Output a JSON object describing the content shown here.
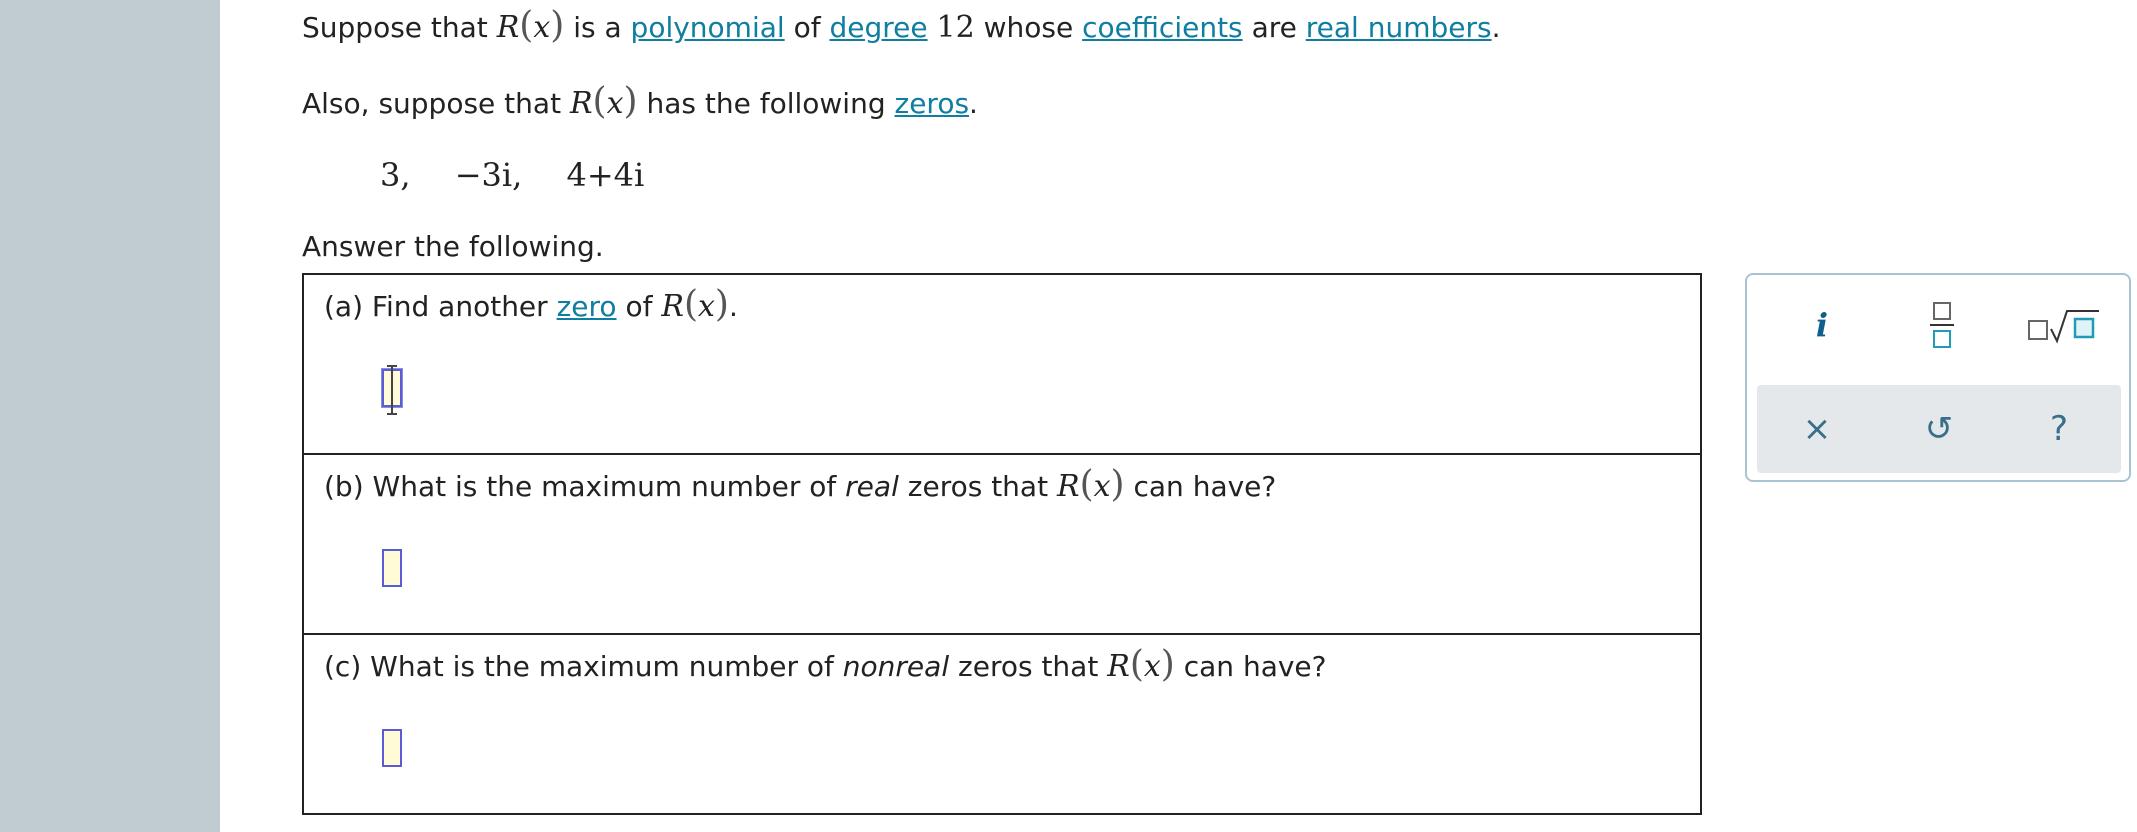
{
  "intro": {
    "line1": {
      "prefix": "Suppose that",
      "func": "R",
      "var": "x",
      "is_a": "is a",
      "term_polynomial": "polynomial",
      "of": "of",
      "term_degree": "degree",
      "degree_value": "12",
      "whose": "whose",
      "term_coefficients": "coefficients",
      "are": "are",
      "term_real_numbers": "real numbers",
      "period": "."
    },
    "line2": {
      "prefix": "Also, suppose that",
      "func": "R",
      "var": "x",
      "mid": "has the following",
      "term_zeros": "zeros",
      "period": "."
    },
    "zeros": [
      "3,",
      "−3i,",
      "4+4i"
    ],
    "answer_prompt": "Answer the following."
  },
  "questions": [
    {
      "prefix": "(a) Find another",
      "term": "zero",
      "mid": "of",
      "func": "R",
      "var": "x",
      "suffix": "."
    },
    {
      "prefix": "(b) What is the maximum number of",
      "emph": "real",
      "mid": "zeros that",
      "func": "R",
      "var": "x",
      "suffix": "can have?"
    },
    {
      "prefix": "(c) What is the maximum number of",
      "emph": "nonreal",
      "mid": "zeros that",
      "func": "R",
      "var": "x",
      "suffix": "can have?"
    }
  ],
  "palette": {
    "imaginary_label": "i",
    "clear_symbol": "×",
    "undo_symbol": "↺",
    "help_symbol": "?"
  },
  "colors": {
    "link": "#0f7ea0",
    "sidebar": "#c0ccd1",
    "answer_box_border": "#5b5bd6",
    "answer_box_fill": "#fffbd6",
    "palette_border": "#a9c3d0",
    "palette_button_bg": "#e4e8eb"
  }
}
